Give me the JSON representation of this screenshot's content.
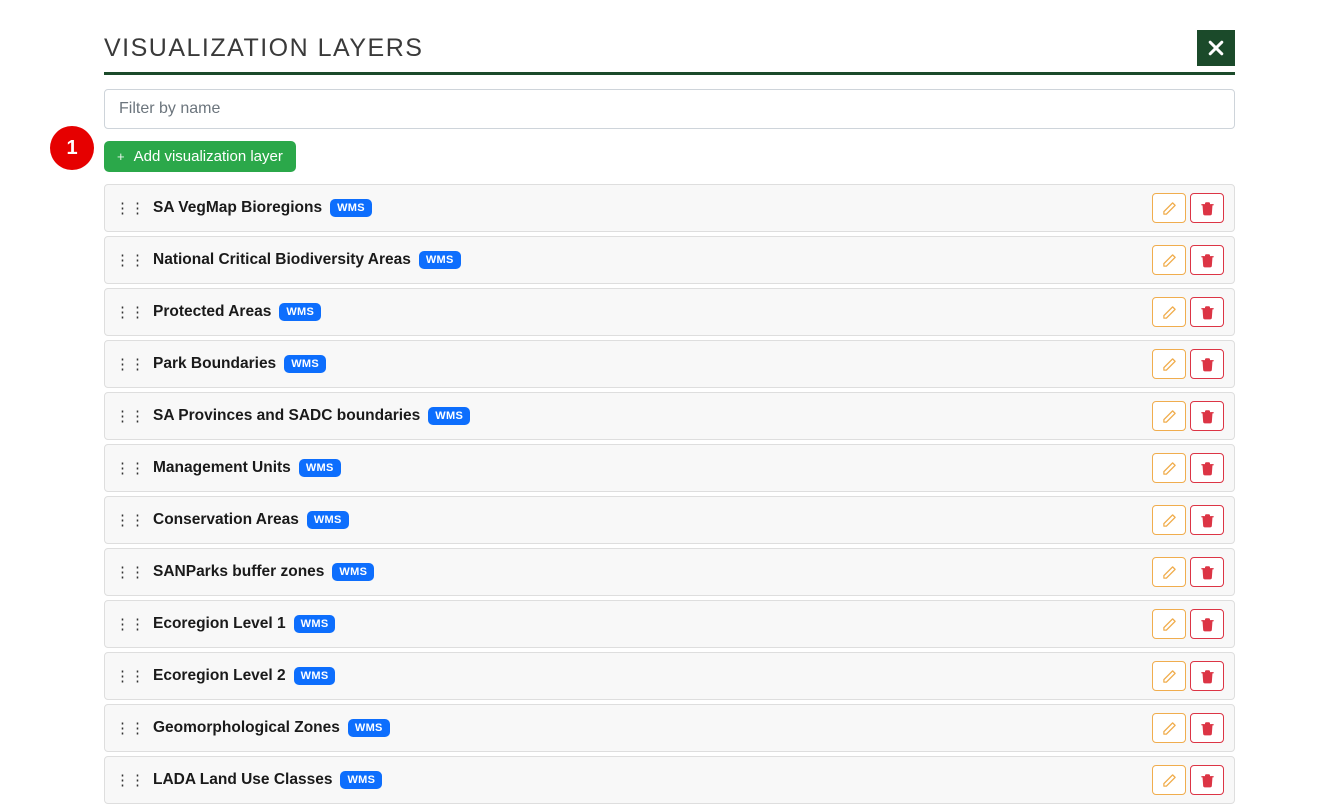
{
  "header": {
    "title": "VISUALIZATION LAYERS"
  },
  "filter": {
    "placeholder": "Filter by name"
  },
  "add_button": {
    "plus": "+",
    "label": "Add visualization layer"
  },
  "badge_text": "WMS",
  "layers": [
    {
      "name": "SA VegMap Bioregions"
    },
    {
      "name": "National Critical Biodiversity Areas"
    },
    {
      "name": "Protected Areas"
    },
    {
      "name": "Park Boundaries"
    },
    {
      "name": "SA Provinces and SADC boundaries"
    },
    {
      "name": "Management Units"
    },
    {
      "name": "Conservation Areas"
    },
    {
      "name": "SANParks buffer zones"
    },
    {
      "name": "Ecoregion Level 1"
    },
    {
      "name": "Ecoregion Level 2"
    },
    {
      "name": "Geomorphological Zones"
    },
    {
      "name": "LADA Land Use Classes"
    }
  ],
  "step_marker": "1"
}
